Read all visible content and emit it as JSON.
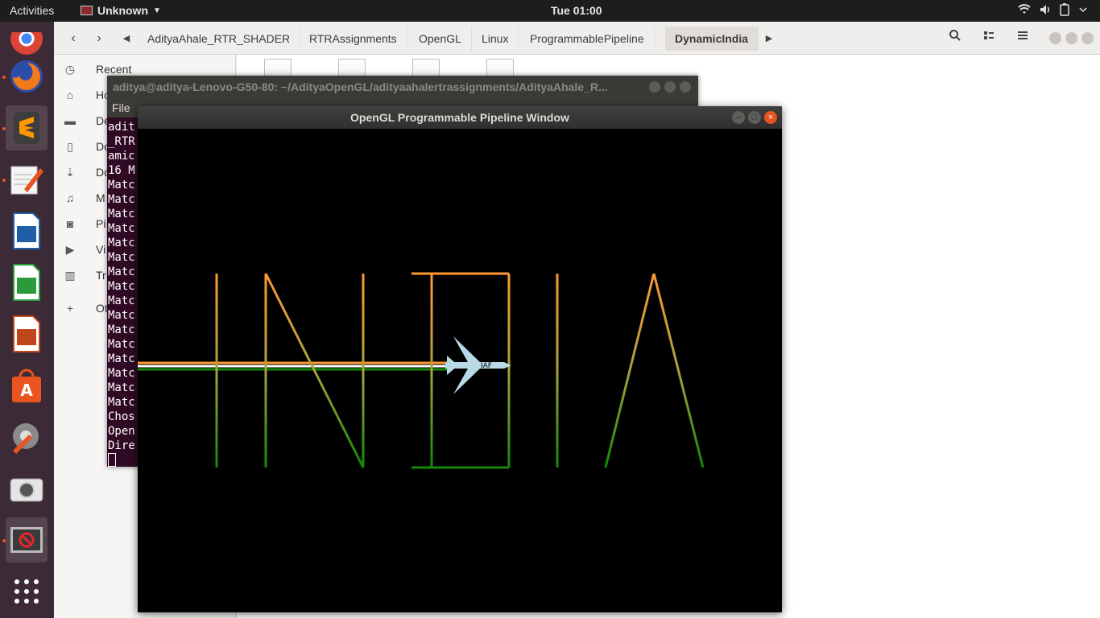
{
  "topbar": {
    "activities": "Activities",
    "app_name": "Unknown",
    "clock": "Tue 01:00"
  },
  "dock": {
    "items": [
      "chrome",
      "firefox",
      "sublime-text",
      "text-editor",
      "writer",
      "calc",
      "impress",
      "software-center",
      "system-settings",
      "screenshot",
      "unknown-app",
      "show-applications"
    ]
  },
  "files": {
    "breadcrumbs": [
      "AdityaAhale_RTR_SHADER",
      "RTRAssignments",
      "OpenGL",
      "Linux",
      "ProgrammablePipeline",
      "DynamicIndia"
    ],
    "active_crumb": "DynamicIndia",
    "sidebar": [
      {
        "label": "Recent",
        "icon": "clock-icon"
      },
      {
        "label": "Ho",
        "icon": "home-icon"
      },
      {
        "label": "De",
        "icon": "folder-icon"
      },
      {
        "label": "Do",
        "icon": "document-icon"
      },
      {
        "label": "Do",
        "icon": "download-icon"
      },
      {
        "label": "M",
        "icon": "music-icon"
      },
      {
        "label": "Pi",
        "icon": "camera-icon"
      },
      {
        "label": "Vi",
        "icon": "video-icon"
      },
      {
        "label": "Tr",
        "icon": "trash-icon"
      },
      {
        "label": "Ot",
        "icon": "plus-icon"
      }
    ]
  },
  "terminal": {
    "title": "aditya@aditya-Lenovo-G50-80: ~/AdityaOpenGL/adityaahalertrassignments/AdityaAhale_R...",
    "menu_file": "File",
    "lines": [
      "adit",
      "_RTR",
      "amic",
      "16 M",
      "Matc",
      "Matc",
      "Matc",
      "Matc",
      "Matc",
      "Matc",
      "Matc",
      "Matc",
      "Matc",
      "Matc",
      "Matc",
      "Matc",
      "Matc",
      "Matc",
      "Matc",
      "Matc",
      "Chos",
      "Open",
      "Dire"
    ]
  },
  "glwindow": {
    "title": "OpenGL Programmable Pipeline Window",
    "plane_label": "IAF",
    "colors": {
      "saffron": "#ff9933",
      "white": "#ffffff",
      "green": "#138808",
      "plane": "#bad9e6"
    }
  }
}
